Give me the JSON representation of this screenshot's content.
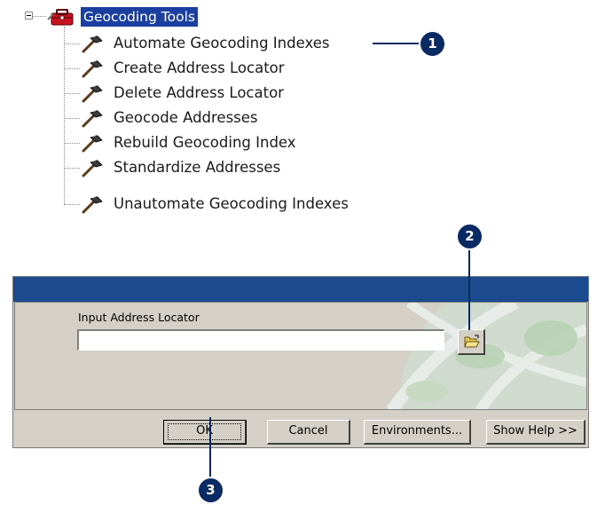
{
  "tree": {
    "root_label": "Geocoding Tools",
    "items": [
      {
        "label": "Automate Geocoding Indexes"
      },
      {
        "label": "Create Address Locator"
      },
      {
        "label": "Delete Address Locator"
      },
      {
        "label": "Geocode Addresses"
      },
      {
        "label": "Rebuild Geocoding Index"
      },
      {
        "label": "Standardize Addresses"
      },
      {
        "label": "Unautomate Geocoding Indexes"
      }
    ]
  },
  "callouts": [
    "1",
    "2",
    "3"
  ],
  "dialog": {
    "field_label": "Input Address Locator",
    "field_value": "",
    "buttons": {
      "ok": "OK",
      "cancel": "Cancel",
      "environments": "Environments...",
      "show_help": "Show Help >>"
    }
  },
  "icons": {
    "root": "toolbox-icon",
    "item": "hammer-icon",
    "browse": "open-folder-icon"
  },
  "colors": {
    "selection": "#1a3fa0",
    "titlebar": "#1b4a8f",
    "callout": "#0a2a63",
    "dialog_face": "#d4d0c8"
  }
}
